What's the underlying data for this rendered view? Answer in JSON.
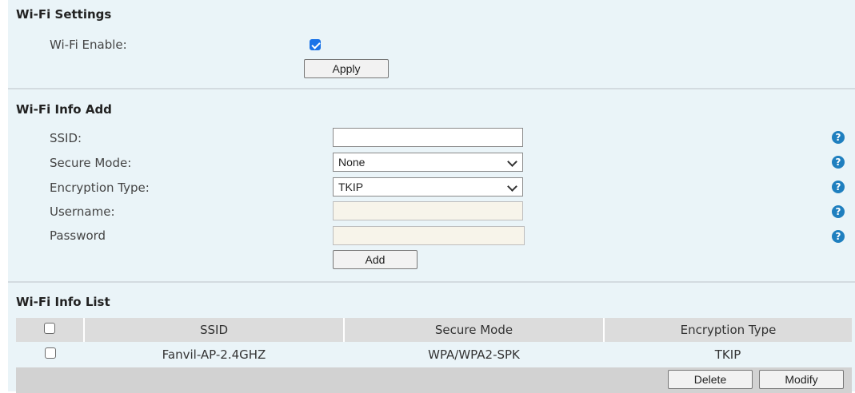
{
  "settings": {
    "title": "Wi-Fi Settings",
    "enable_label": "Wi-Fi Enable:",
    "enable_checked": true,
    "apply_label": "Apply"
  },
  "add": {
    "title": "Wi-Fi Info Add",
    "ssid_label": "SSID:",
    "ssid_value": "",
    "secure_mode_label": "Secure Mode:",
    "secure_mode_value": "None",
    "encryption_label": "Encryption Type:",
    "encryption_value": "TKIP",
    "username_label": "Username:",
    "password_label": "Password",
    "add_label": "Add",
    "help_icon": "?"
  },
  "list": {
    "title": "Wi-Fi Info List",
    "columns": [
      "SSID",
      "Secure Mode",
      "Encryption Type"
    ],
    "rows": [
      {
        "ssid": "Fanvil-AP-2.4GHZ",
        "secure_mode": "WPA/WPA2-SPK",
        "encryption": "TKIP",
        "checked": false
      }
    ],
    "delete_label": "Delete",
    "modify_label": "Modify"
  },
  "colors": {
    "panel_bg": "#eaf4f8",
    "accent": "#1a73e8",
    "help_icon": "#1f7fbf"
  }
}
